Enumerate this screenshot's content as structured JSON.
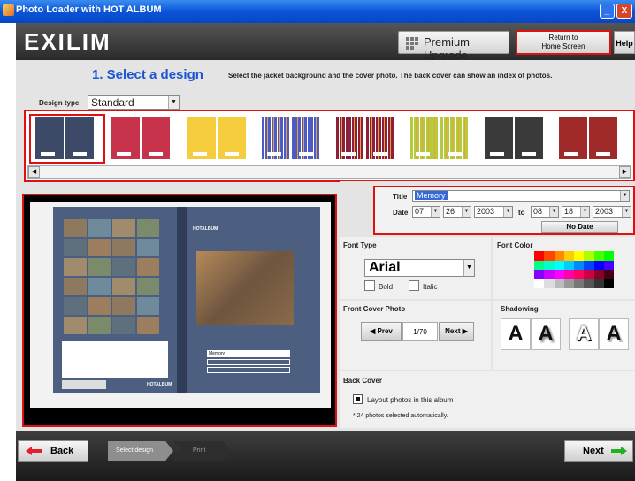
{
  "window": {
    "title": "Photo Loader with HOT ALBUM",
    "buttons": [
      "_",
      "□",
      "X"
    ]
  },
  "header": {
    "logo": "EXILIM",
    "premium_label": "Premium Upgrade",
    "home_line1": "Return to",
    "home_line2": "Home Screen",
    "help_label": "Help"
  },
  "step": {
    "title": "1. Select a design",
    "description": "Select the jacket background and the cover photo. The back cover can show an index of photos."
  },
  "design_type": {
    "label": "Design type",
    "value": "Standard"
  },
  "designs": [
    {
      "name": "navy",
      "color": "#3c4a68"
    },
    {
      "name": "red",
      "color": "#c7334b"
    },
    {
      "name": "yellow",
      "color": "#f4cc3c"
    },
    {
      "name": "blue-stripes",
      "color": "#4c5cc4"
    },
    {
      "name": "multi-stripes",
      "color": "#8c2038"
    },
    {
      "name": "green-stripes",
      "color": "#b4cc3c"
    },
    {
      "name": "dark",
      "color": "#3a3a3a"
    },
    {
      "name": "dark-red",
      "color": "#a02a2a"
    }
  ],
  "title_date": {
    "title_label": "Title",
    "title_value": "Memory",
    "date_label": "Date",
    "from_month": "07",
    "from_day": "26",
    "from_year": "2003",
    "to_label": "to",
    "to_month": "08",
    "to_day": "18",
    "to_year": "2003",
    "no_date_label": "No Date"
  },
  "font": {
    "type_label": "Font Type",
    "value": "Arial",
    "bold_label": "Bold",
    "italic_label": "Italic",
    "color_label": "Font Color"
  },
  "front_cover": {
    "label": "Front Cover Photo",
    "prev_label": "Prev",
    "next_label": "Next",
    "count": "1/70"
  },
  "shadowing": {
    "label": "Shadowing",
    "glyph": "A"
  },
  "back_cover": {
    "label": "Back Cover",
    "option_label": "Layout photos in this album",
    "note": "* 24 photos selected automatically."
  },
  "preview": {
    "brand": "HOTALBUM",
    "cover_title": "Memory"
  },
  "footer": {
    "back_label": "Back",
    "next_label": "Next",
    "crumb1": "Select design",
    "crumb2": "Print"
  },
  "accent": "#1a55d5",
  "highlight": "#dd1111"
}
